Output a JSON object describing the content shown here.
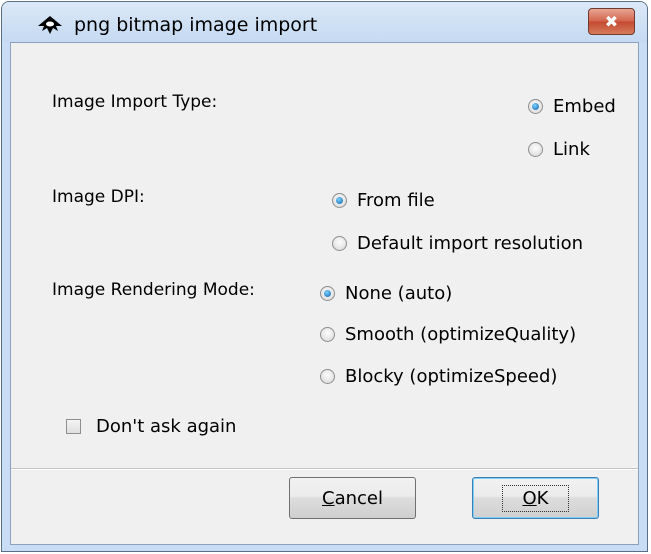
{
  "window": {
    "title": "png bitmap image import",
    "close_glyph": "✖"
  },
  "import_type": {
    "label": "Image Import Type:",
    "options": [
      "Embed",
      "Link"
    ],
    "selected": "Embed"
  },
  "dpi": {
    "label": "Image DPI:",
    "options": [
      "From file",
      "Default import resolution"
    ],
    "selected": "From file"
  },
  "rendering": {
    "label": "Image Rendering Mode:",
    "options": [
      "None (auto)",
      "Smooth (optimizeQuality)",
      "Blocky (optimizeSpeed)"
    ],
    "selected": "None (auto)"
  },
  "dont_ask": {
    "label": "Don't ask again",
    "checked": false
  },
  "buttons": {
    "cancel_mnemonic": "C",
    "cancel_rest": "ancel",
    "ok_mnemonic": "O",
    "ok_rest": "K"
  },
  "colors": {
    "title_bar": "#c9def5",
    "close_button": "#c94a30",
    "radio_selected": "#0d5fa8"
  }
}
